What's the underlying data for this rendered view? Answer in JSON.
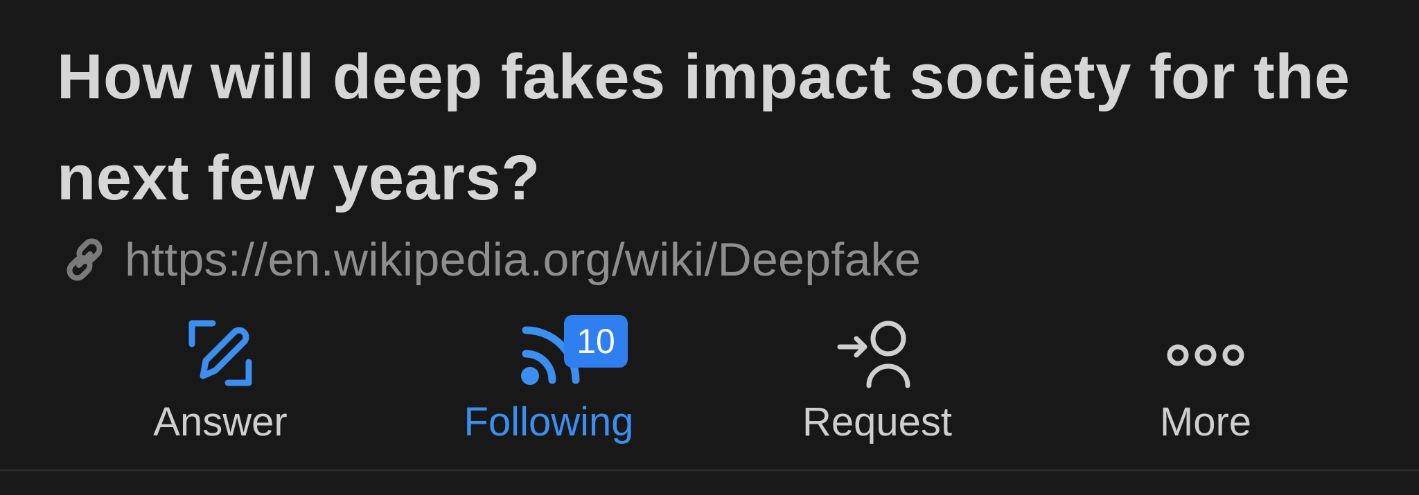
{
  "question": {
    "title": "How will deep fakes impact society for the next few years?",
    "link": "https://en.wikipedia.org/wiki/Deepfake",
    "link_icon": "link-icon"
  },
  "actions": [
    {
      "label": "Answer",
      "icon": "pencil-square-icon",
      "active": false
    },
    {
      "label": "Following",
      "icon": "rss-feed-icon",
      "active": true,
      "badge": "10"
    },
    {
      "label": "Request",
      "icon": "person-arrow-icon",
      "active": false
    },
    {
      "label": "More",
      "icon": "ellipsis-icon",
      "active": false
    }
  ],
  "colors": {
    "background": "#181818",
    "title": "#d6d6d6",
    "link": "#8e8e8e",
    "accent": "#3b8ff0",
    "badge": "#2f7ff0",
    "label": "#cfcfcf"
  }
}
